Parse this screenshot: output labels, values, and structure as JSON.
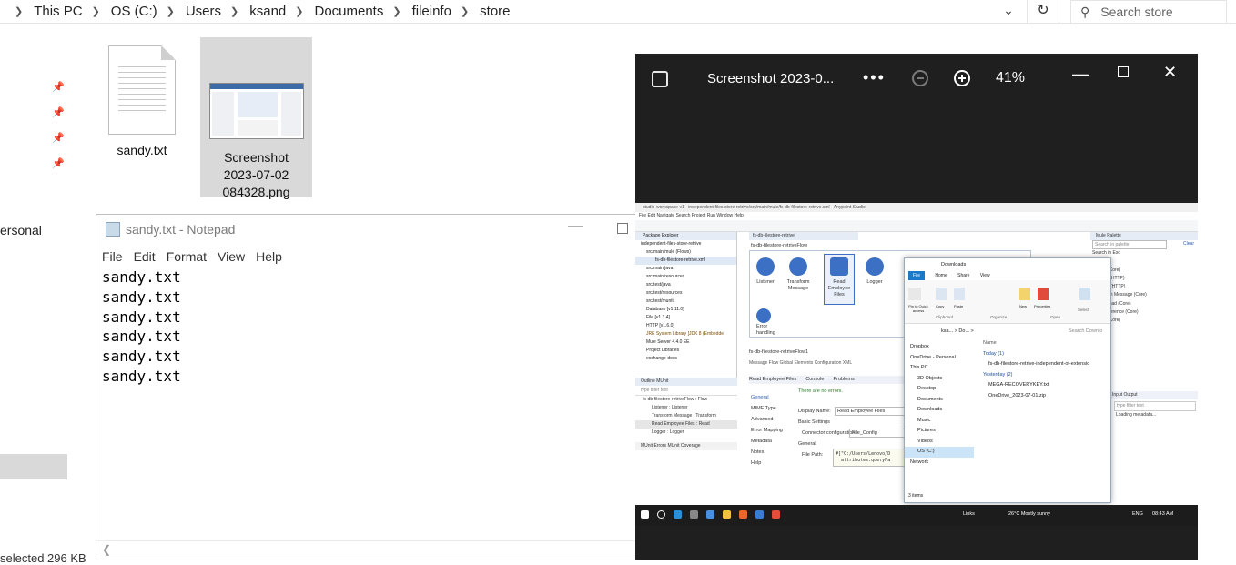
{
  "explorer": {
    "breadcrumb": [
      "This PC",
      "OS (C:)",
      "Users",
      "ksand",
      "Documents",
      "fileinfo",
      "store"
    ],
    "search_placeholder": "Search store",
    "sidebar_fragment": "ersonal",
    "status_fragment": "selected  296 KB",
    "files": [
      {
        "name": "sandy.txt",
        "icon": "text-file-icon"
      },
      {
        "name": "Screenshot\n2023-07-02\n084328.png",
        "icon": "image-thumbnail",
        "selected": true
      }
    ]
  },
  "notepad": {
    "title": "sandy.txt - Notepad",
    "menu": [
      "File",
      "Edit",
      "Format",
      "View",
      "Help"
    ],
    "lines": [
      "sandy.txt",
      "sandy.txt",
      "sandy.txt",
      "sandy.txt",
      "sandy.txt",
      "sandy.txt"
    ]
  },
  "photos": {
    "title": "Screenshot 2023-0...",
    "more": "•••",
    "zoom": "41%",
    "embedded": {
      "ide_title": "studio-workspace-v1 - independent-files-store-retrive/src/main/mule/fs-db-filestore-retrive.xml - Anypoint Studio",
      "ide_menu": "File  Edit  Navigate  Search  Project  Run  Window  Help",
      "package_explorer": {
        "header": "Package Explorer",
        "items": [
          "independent-files-store-retrive",
          "src/main/mule (Flows)",
          "fs-db-filestore-retrive.xml",
          "src/main/java",
          "src/main/resources",
          "src/test/java",
          "src/test/resources",
          "src/test/munit",
          "Database [v1.11.0]",
          "File [v1.3.4]",
          "HTTP [v1.6.0]",
          "JRE System Library [JDK 8 (Embedde",
          "Mule Server 4.4.0 EE",
          "Project Libraries",
          "exchange-docs"
        ]
      },
      "flow_tab": "fs-db-filestore-retrive",
      "flow_name": "fs-db-filestore-retriveFlow",
      "nodes": [
        "Listener",
        "Transform\nMessage",
        "Read\nEmployee\nFiles",
        "Logger"
      ],
      "error_label": "Error\nhandling",
      "flow2_name": "fs-db-filestore-retriveFlow1",
      "editor_tabs": "Message Flow   Global Elements   Configuration XML",
      "outline": {
        "tabs": "Outline    MUnit",
        "filter": "type filter text",
        "items": [
          "fs-db-filestore-retriveFlow : Flow",
          "Listener : Listener",
          "Transform Message : Transform",
          "Read Employee Files : Read",
          "Logger : Logger"
        ],
        "munit": "MUnit Errors    MUnit Coverage"
      },
      "props": {
        "tab": "Read Employee Files",
        "console": "Console",
        "problems": "Problems",
        "nav": [
          "General",
          "MIME Type",
          "Advanced",
          "Error Mapping",
          "Metadata",
          "Notes",
          "Help"
        ],
        "no_errors": "There are no errors.",
        "display_name_label": "Display Name:",
        "display_name": "Read Employee Files",
        "basic": "Basic Settings",
        "connector_label": "Connector configuration:",
        "connector": "File_Config",
        "general": "General",
        "file_path_label": "File Path:",
        "file_path": "#[\"C:/Users/Lenovo/D\n  attributes.queryPa"
      },
      "palette": {
        "header": "Mule Palette",
        "search": "Search in palette",
        "clear": "Clear",
        "items": [
          "Search in Exc",
          "odules",
          "Logger (Core)",
          "Listener (HTTP)",
          "Request (HTTP)",
          "Transform Message (Core)",
          "Set Payload (Core)",
          "Flow Reference (Core)",
          "Choice (Core)"
        ]
      },
      "output": {
        "tabs": "Input   Output",
        "filter": "type filter text",
        "loading": "Loading metadata..."
      },
      "downloads": {
        "title": "Downloads",
        "ribbon_tabs": [
          "File",
          "Home",
          "Share",
          "View"
        ],
        "ribbon_groups": [
          "Clipboard",
          "Organize",
          "Open",
          "Select"
        ],
        "ribbon_buttons": [
          "Pin to Quick access",
          "Copy",
          "Paste",
          "New",
          "Properties"
        ],
        "nav_path": "ksa...  >  Do...  >",
        "search": "Search Downlo",
        "tree": [
          "Dropbox",
          "OneDrive - Personal",
          "This PC",
          "3D Objects",
          "Desktop",
          "Documents",
          "Downloads",
          "Music",
          "Pictures",
          "Videos",
          "OS (C:)",
          "Network"
        ],
        "selected_tree": "OS (C:)",
        "col_name": "Name",
        "groups": [
          {
            "label": "Today (1)",
            "files": [
              "fs-db-filestore-retrive-independent-of-extensio"
            ]
          },
          {
            "label": "Yesterday (2)",
            "files": [
              "MEGA-RECOVERYKEY.txt",
              "OneDrive_2023-07-01.zip"
            ]
          }
        ],
        "status": "3 items"
      },
      "taskbar": {
        "links": "Links",
        "weather": "26°C  Mostly sunny",
        "lang": "ENG",
        "time": "08:43 AM"
      }
    }
  }
}
